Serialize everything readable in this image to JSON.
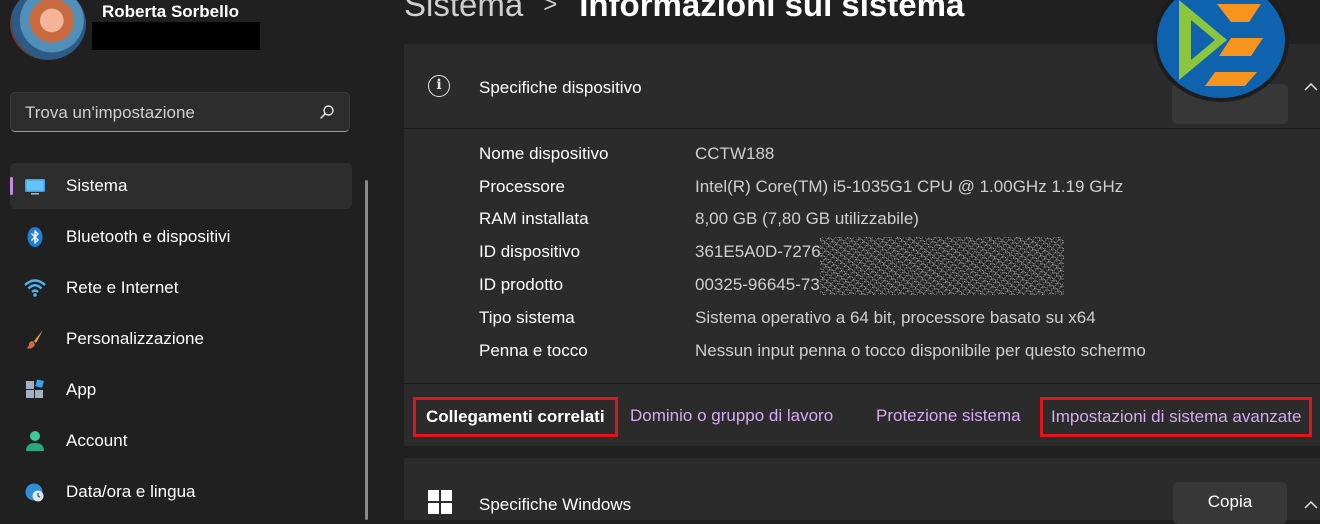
{
  "sidebar": {
    "user_name": "Roberta Sorbello",
    "search_placeholder": "Trova un'impostazione",
    "items": [
      {
        "label": "Sistema",
        "icon": "monitor-icon",
        "active": true
      },
      {
        "label": "Bluetooth e dispositivi",
        "icon": "bluetooth-icon",
        "active": false
      },
      {
        "label": "Rete e Internet",
        "icon": "wifi-icon",
        "active": false
      },
      {
        "label": "Personalizzazione",
        "icon": "brush-icon",
        "active": false
      },
      {
        "label": "App",
        "icon": "apps-icon",
        "active": false
      },
      {
        "label": "Account",
        "icon": "person-icon",
        "active": false
      },
      {
        "label": "Data/ora e lingua",
        "icon": "globe-clock-icon",
        "active": false
      }
    ]
  },
  "header": {
    "breadcrumb_parent": "Sistema",
    "breadcrumb_separator": ">",
    "breadcrumb_current": "Informazioni sul sistema"
  },
  "device_specs": {
    "title": "Specifiche dispositivo",
    "rows": [
      {
        "label": "Nome dispositivo",
        "value": "CCTW188"
      },
      {
        "label": "Processore",
        "value": "Intel(R) Core(TM) i5-1035G1 CPU @ 1.00GHz   1.19 GHz"
      },
      {
        "label": "RAM installata",
        "value": "8,00 GB (7,80 GB utilizzabile)"
      },
      {
        "label": "ID dispositivo",
        "value": "361E5A0D-7276"
      },
      {
        "label": "ID prodotto",
        "value": "00325-96645-73"
      },
      {
        "label": "Tipo sistema",
        "value": "Sistema operativo a 64 bit, processore basato su x64"
      },
      {
        "label": "Penna e tocco",
        "value": "Nessun input penna o tocco disponibile per questo schermo"
      }
    ]
  },
  "related": {
    "title": "Collegamenti correlati",
    "links": [
      "Dominio o gruppo di lavoro",
      "Protezione sistema",
      "Impostazioni di sistema avanzate"
    ]
  },
  "windows_specs": {
    "title": "Specifiche Windows",
    "copy_label": "Copia"
  },
  "colors": {
    "background": "#202020",
    "card": "#2b2b2b",
    "accent_link": "#d9a9f2",
    "highlight_box": "#e0141c",
    "nav_indicator": "#c58ae6"
  }
}
